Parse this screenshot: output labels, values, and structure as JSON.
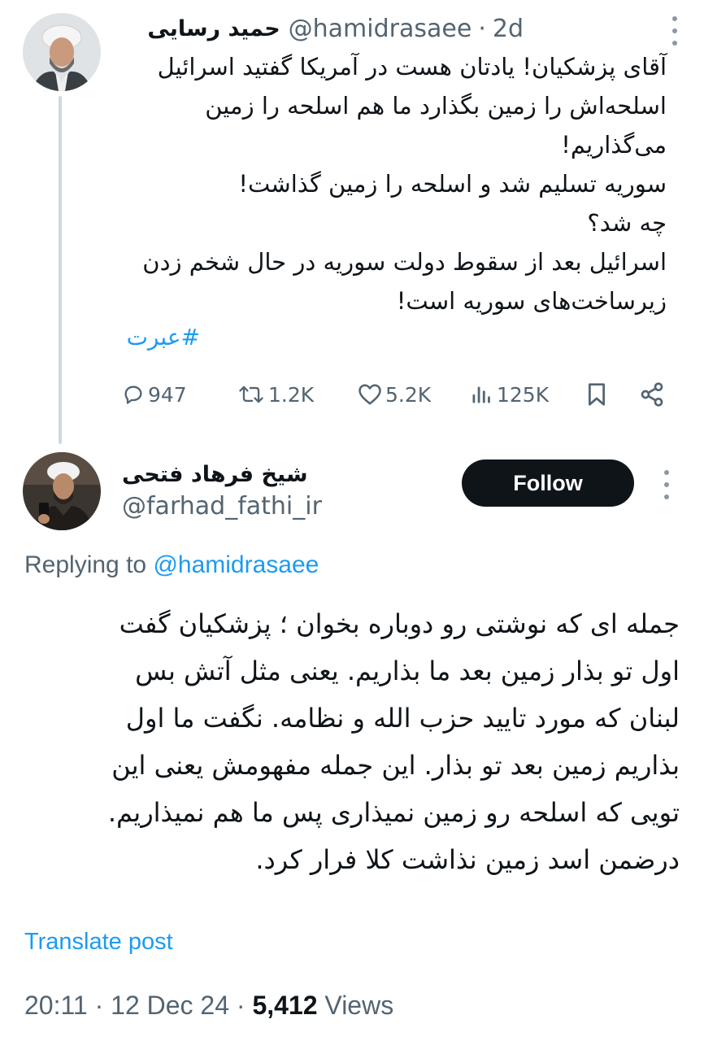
{
  "tweet": {
    "author_name": "حمید رسایی",
    "author_handle": "@hamidrasaee",
    "separator": "·",
    "time_ago": "2d",
    "text": "آقای پزشکیان! یادتان هست در آمریکا گفتید اسرائیل\nاسلحه‌اش را زمین بگذارد ما هم اسلحه را زمین\nمی‌گذاریم!\nسوریه تسلیم شد و اسلحه را زمین گذاشت!\nچه شد؟\nاسرائیل بعد از سقوط دولت سوریه در حال شخم زدن\nزیرساخت‌های سوریه است!",
    "hashtag": "#عبرت",
    "stats": {
      "replies": "947",
      "reposts": "1.2K",
      "likes": "5.2K",
      "views": "125K"
    },
    "icons": {
      "more": "more-dots-icon",
      "reply": "reply-bubble-icon",
      "repost": "repost-icon",
      "like": "heart-icon",
      "views": "views-bar-icon",
      "bookmark": "bookmark-icon",
      "share": "share-icon"
    }
  },
  "reply": {
    "author_name": "شیخ فرهاد فتحی",
    "author_handle": "@farhad_fathi_ir",
    "follow_label": "Follow",
    "replying_prefix": "Replying to",
    "replying_handle": "@hamidrasaee",
    "text": "جمله ای که نوشتی رو دوباره بخوان ؛ پزشکیان گفت\nاول تو بذار زمین بعد ما بذاریم. یعنی مثل آتش بس\nلبنان که مورد تایید حزب الله و نظامه. نگفت ما اول\nبذاریم زمین بعد تو بذار. این جمله مفهومش یعنی این\nتویی که اسلحه رو زمین نمیذاری پس ما هم نمیذاریم.\nدرضمن اسد زمین نذاشت کلا فرار کرد.",
    "translate_label": "Translate post",
    "timestamp": "20:11 · 12 Dec 24",
    "meta_sep": "·",
    "views_count": "5,412",
    "views_label": "Views"
  },
  "colors": {
    "text": "#0f1419",
    "muted": "#536471",
    "accent": "#1d9bf0",
    "button_bg": "#0f1419",
    "thread_line": "#cfd9de"
  }
}
